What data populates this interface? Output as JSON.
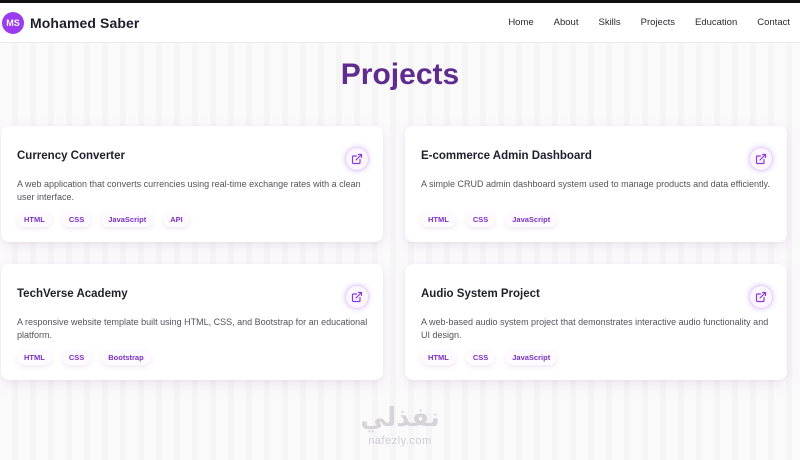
{
  "brand": {
    "initials": "MS",
    "name": "Mohamed Saber"
  },
  "nav": [
    {
      "label": "Home"
    },
    {
      "label": "About"
    },
    {
      "label": "Skills"
    },
    {
      "label": "Projects"
    },
    {
      "label": "Education"
    },
    {
      "label": "Contact"
    }
  ],
  "section": {
    "title": "Projects"
  },
  "projects": [
    {
      "title": "Currency Converter",
      "description": "A web application that converts currencies using real-time exchange rates with a clean user interface.",
      "tags": [
        "HTML",
        "CSS",
        "JavaScript",
        "API"
      ],
      "link_icon": "external-link-icon"
    },
    {
      "title": "E-commerce Admin Dashboard",
      "description": "A simple CRUD admin dashboard system used to manage products and data efficiently.",
      "tags": [
        "HTML",
        "CSS",
        "JavaScript"
      ],
      "link_icon": "external-link-icon"
    },
    {
      "title": "TechVerse Academy",
      "description": "A responsive website template built using HTML, CSS, and Bootstrap for an educational platform.",
      "tags": [
        "HTML",
        "CSS",
        "Bootstrap"
      ],
      "link_icon": "external-link-icon"
    },
    {
      "title": "Audio System Project",
      "description": "A web-based audio system project that demonstrates interactive audio functionality and UI design.",
      "tags": [
        "HTML",
        "CSS",
        "JavaScript"
      ],
      "link_icon": "external-link-icon"
    }
  ],
  "watermark": {
    "arabic": "نفذلي",
    "latin": "nafezly.com"
  },
  "colors": {
    "accent": "#9b3bf0",
    "title": "#5e2c8f",
    "tag_text": "#7b2fbf"
  }
}
